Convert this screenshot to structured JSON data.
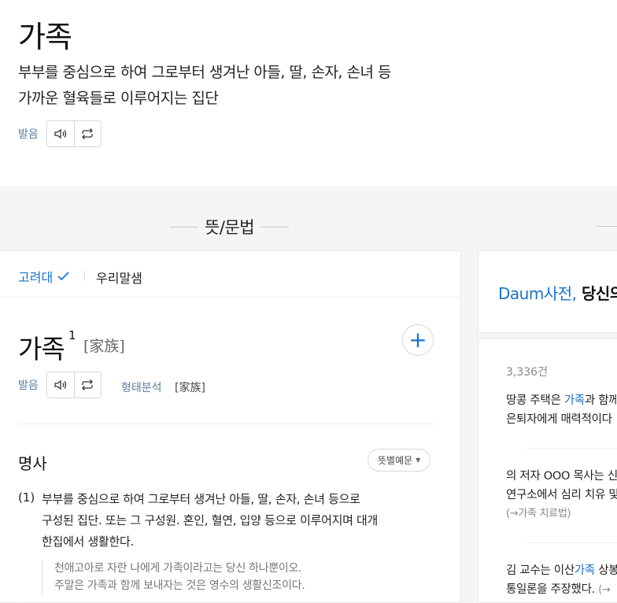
{
  "header": {
    "word": "가족",
    "definition_line1": "부부를 중심으로 하여 그로부터 생겨난 아들, 딸, 손자, 손녀 등",
    "definition_line2": "가까운 혈육들로 이루어지는 집단",
    "pron_label": "발음"
  },
  "section": {
    "title": "뜻/문법"
  },
  "dict_tabs": {
    "active": "고려대",
    "other": "우리말샘"
  },
  "entry": {
    "word": "가족",
    "superscript": "1",
    "hanja": "[家族]",
    "pron_label": "발음",
    "morph_label": "형태분석",
    "morph_value": "[家族]",
    "add_label": "+",
    "part_of_speech": "명사",
    "filter_label": "뜻별예문",
    "sense_number": "(1)",
    "sense_line1": "부부를 중심으로 하여 그로부터 생겨난 아들, 딸, 손자, 손녀 등으로",
    "sense_line2": "구성된 집단. 또는 그 구성원. 혼인, 혈연, 입양 등으로 이루어지며 대개",
    "sense_line3": "한집에서 생활한다.",
    "example1": "천애고아로 자란 나에게 가족이라고는 당신 하나뿐이오.",
    "example2": "주말은 가족과 함께 보내자는 것은 영수의 생활신조이다."
  },
  "promo": {
    "brand": "Daum사전,",
    "rest": " 당신의 "
  },
  "examples_panel": {
    "count": "3,336건",
    "item1_a": "땅콩 주택은 ",
    "item1_hl": "가족",
    "item1_b": "과 함께",
    "item1_line2": "은퇴자에게 매력적이다",
    "item2_line1": "의 저자 OOO 목사는 신",
    "item2_line2": "연구소에서 심리 치유 및",
    "item2_src": "(→가족 치료법)",
    "item3_a": "김 교수는 이산",
    "item3_hl": "가족",
    "item3_b": " 상봉",
    "item3_line2": "통일론을 주장했다. ",
    "item3_src": "(→"
  },
  "colors": {
    "accent": "#1a73c9",
    "label": "#5b7d9e",
    "panel_bg": "#f4f5f7"
  },
  "icons": [
    "speaker-icon",
    "repeat-icon",
    "check-icon",
    "plus-icon",
    "caret-down-icon"
  ]
}
